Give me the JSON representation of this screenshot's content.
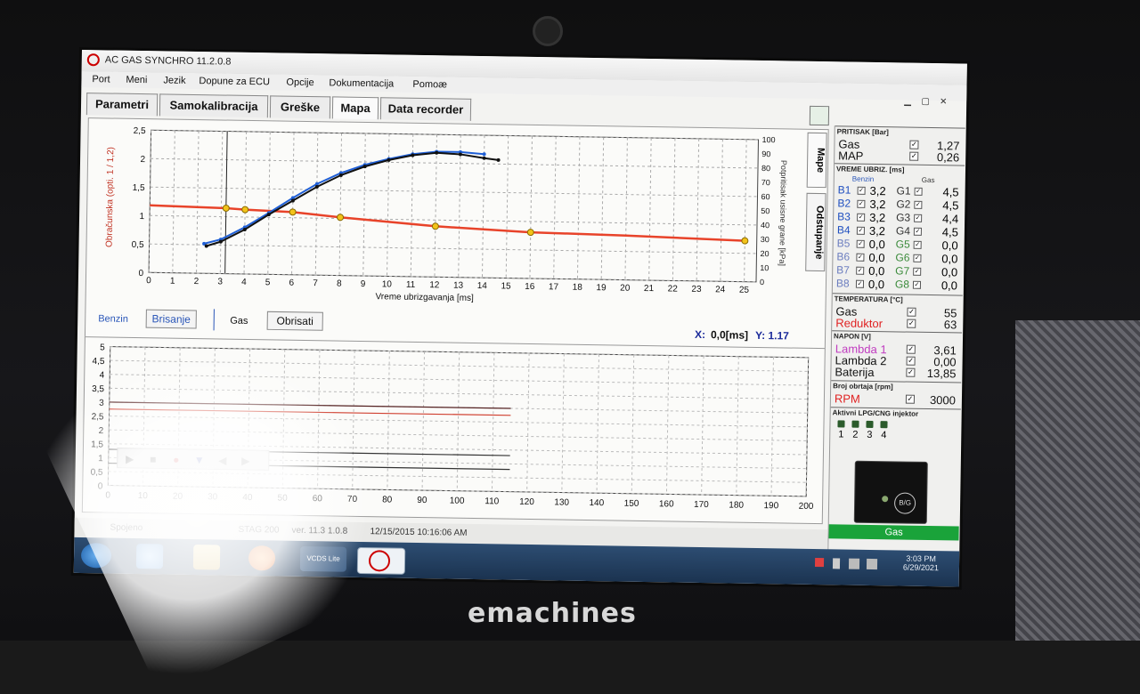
{
  "window": {
    "title": "AC GAS SYNCHRO  11.2.0.8"
  },
  "menu": [
    "Port",
    "Meni",
    "Jezik",
    "Dopune za ECU",
    "Opcije",
    "Dokumentacija",
    "Pomoæ"
  ],
  "tabs": [
    "Parametri",
    "Samokalibracija",
    "Greške",
    "Mapa",
    "Data recorder"
  ],
  "active_tab": "Mapa",
  "side_tabs": [
    "Mape",
    "Odstupanje"
  ],
  "chart_data": [
    {
      "type": "line",
      "x": [
        0,
        1,
        2,
        3,
        4,
        5,
        6,
        7,
        8,
        9,
        10,
        11,
        12,
        13,
        14,
        15,
        16,
        17,
        18,
        19,
        20,
        21,
        22,
        23,
        24,
        25
      ],
      "xlabel": "Vreme ubrizgavanja [ms]",
      "ylabel": "Obračunska (opti. 1 / 1,2)",
      "ylim": [
        0,
        2.5
      ],
      "y_ticks": [
        "0",
        "0,5",
        "1",
        "1,5",
        "2",
        "2,5"
      ],
      "y2label": "Potpritisak usisne grane [kPa]",
      "y2lim": [
        0,
        100
      ],
      "y2_ticks": [
        "0",
        "10",
        "20",
        "30",
        "40",
        "50",
        "60",
        "70",
        "80",
        "90",
        "100"
      ],
      "series": [
        {
          "name": "correction",
          "color": "#e8432a",
          "points": [
            [
              0,
              1.18
            ],
            [
              3.2,
              1.15
            ],
            [
              4,
              1.13
            ],
            [
              6,
              1.1
            ],
            [
              8,
              1.02
            ],
            [
              12,
              0.89
            ],
            [
              16,
              0.81
            ],
            [
              20,
              0.78
            ],
            [
              25,
              0.72
            ]
          ],
          "markers_x": [
            3.2,
            4,
            6,
            8,
            12,
            16,
            25
          ]
        },
        {
          "name": "benzin",
          "color": "#1f5fd6",
          "points": [
            [
              2.3,
              0.52
            ],
            [
              3,
              0.6
            ],
            [
              4,
              0.82
            ],
            [
              5,
              1.08
            ],
            [
              6,
              1.35
            ],
            [
              7,
              1.6
            ],
            [
              8,
              1.8
            ],
            [
              9,
              1.95
            ],
            [
              10,
              2.06
            ],
            [
              11,
              2.15
            ],
            [
              12,
              2.2
            ],
            [
              13,
              2.2
            ],
            [
              14,
              2.17
            ]
          ]
        },
        {
          "name": "gas",
          "color": "#111111",
          "points": [
            [
              2.4,
              0.48
            ],
            [
              3,
              0.56
            ],
            [
              4,
              0.78
            ],
            [
              5,
              1.05
            ],
            [
              6,
              1.3
            ],
            [
              7,
              1.55
            ],
            [
              8,
              1.76
            ],
            [
              9,
              1.92
            ],
            [
              10,
              2.04
            ],
            [
              11,
              2.13
            ],
            [
              12,
              2.18
            ],
            [
              13,
              2.16
            ],
            [
              14,
              2.1
            ],
            [
              14.6,
              2.07
            ]
          ]
        }
      ],
      "cursor": {
        "x": 3.2
      }
    },
    {
      "type": "line",
      "x_ticks": [
        "0",
        "10",
        "20",
        "30",
        "40",
        "50",
        "60",
        "70",
        "80",
        "90",
        "100",
        "110",
        "120",
        "130",
        "140",
        "150",
        "160",
        "170",
        "180",
        "190",
        "200"
      ],
      "xlim": [
        0,
        200
      ],
      "ylim": [
        0,
        5
      ],
      "y_ticks": [
        "0",
        "0,5",
        "1",
        "1,5",
        "2",
        "2,5",
        "3",
        "3,5",
        "4",
        "4,5",
        "5"
      ],
      "series": [
        {
          "name": "line-dark-3",
          "color": "#552222",
          "y": 3.0,
          "x_end": 115
        },
        {
          "name": "line-red-2.7",
          "color": "#d04030",
          "y": 2.75,
          "x_end": 115
        },
        {
          "name": "line-dark-1.3",
          "color": "#333333",
          "y": 1.3,
          "x_end": 115
        },
        {
          "name": "line-dark-0.8",
          "color": "#333333",
          "y": 0.8,
          "x_end": 115
        }
      ]
    }
  ],
  "cursor_readout": {
    "x_label": "X:",
    "x_value": "0,0[ms]",
    "y_label": "Y: 1.17"
  },
  "controls": {
    "benzin_label": "Benzin",
    "brisanje": "Brisanje",
    "gas_label": "Gas",
    "obrisati": "Obrisati"
  },
  "panel": {
    "pritisak": {
      "title": "PRITISAK [Bar]",
      "rows": [
        {
          "label": "Gas",
          "value": "1,27"
        },
        {
          "label": "MAP",
          "value": "0,26"
        }
      ]
    },
    "vreme": {
      "title": "VREME UBRIZ. [ms]",
      "benzin_head": "Benzin",
      "gas_head": "Gas",
      "rows": [
        {
          "b": "B1",
          "bv": "3,2",
          "g": "G1",
          "gv": "4,5"
        },
        {
          "b": "B2",
          "bv": "3,2",
          "g": "G2",
          "gv": "4,5"
        },
        {
          "b": "B3",
          "bv": "3,2",
          "g": "G3",
          "gv": "4,4"
        },
        {
          "b": "B4",
          "bv": "3,2",
          "g": "G4",
          "gv": "4,5"
        },
        {
          "b": "B5",
          "bv": "0,0",
          "g": "G5",
          "gv": "0,0"
        },
        {
          "b": "B6",
          "bv": "0,0",
          "g": "G6",
          "gv": "0,0"
        },
        {
          "b": "B7",
          "bv": "0,0",
          "g": "G7",
          "gv": "0,0"
        },
        {
          "b": "B8",
          "bv": "0,0",
          "g": "G8",
          "gv": "0,0"
        }
      ]
    },
    "temperatura": {
      "title": "TEMPERATURA [°C]",
      "rows": [
        {
          "label": "Gas",
          "value": "55"
        },
        {
          "label": "Reduktor",
          "value": "63"
        }
      ]
    },
    "napon": {
      "title": "NAPON [V]",
      "rows": [
        {
          "label": "Lambda 1",
          "value": "3,61"
        },
        {
          "label": "Lambda 2",
          "value": "0,00"
        },
        {
          "label": "Baterija",
          "value": "13,85"
        }
      ]
    },
    "obrtaji": {
      "title": "Broj obrtaja [rpm]",
      "label": "RPM",
      "value": "3000"
    },
    "aktivni": {
      "title": "Aktivni LPG/CNG injektor",
      "injectors": [
        "1",
        "2",
        "3",
        "4"
      ]
    },
    "mode_badge": "B/G",
    "mode_status": "Gas"
  },
  "status": {
    "left": "Spojeno",
    "device": "STAG 200",
    "version": "ver. 11.3  1.0.8",
    "datetime": "12/15/2015 10:16:06 AM"
  },
  "taskbar": {
    "time": "3:03 PM",
    "date": "6/29/2021",
    "pinned": [
      "start-orb",
      "ie",
      "explorer",
      "media",
      "vcds",
      "ac-gas"
    ],
    "vcds_label": "VCDS Lite"
  },
  "bezel_brand": "emachines",
  "colors": {
    "accent_blue": "#1f5fd6",
    "accent_red": "#e8432a",
    "marker_yellow": "#f2c31a",
    "mode_green": "#1aa33a",
    "label_magenta": "#c03cc0"
  }
}
